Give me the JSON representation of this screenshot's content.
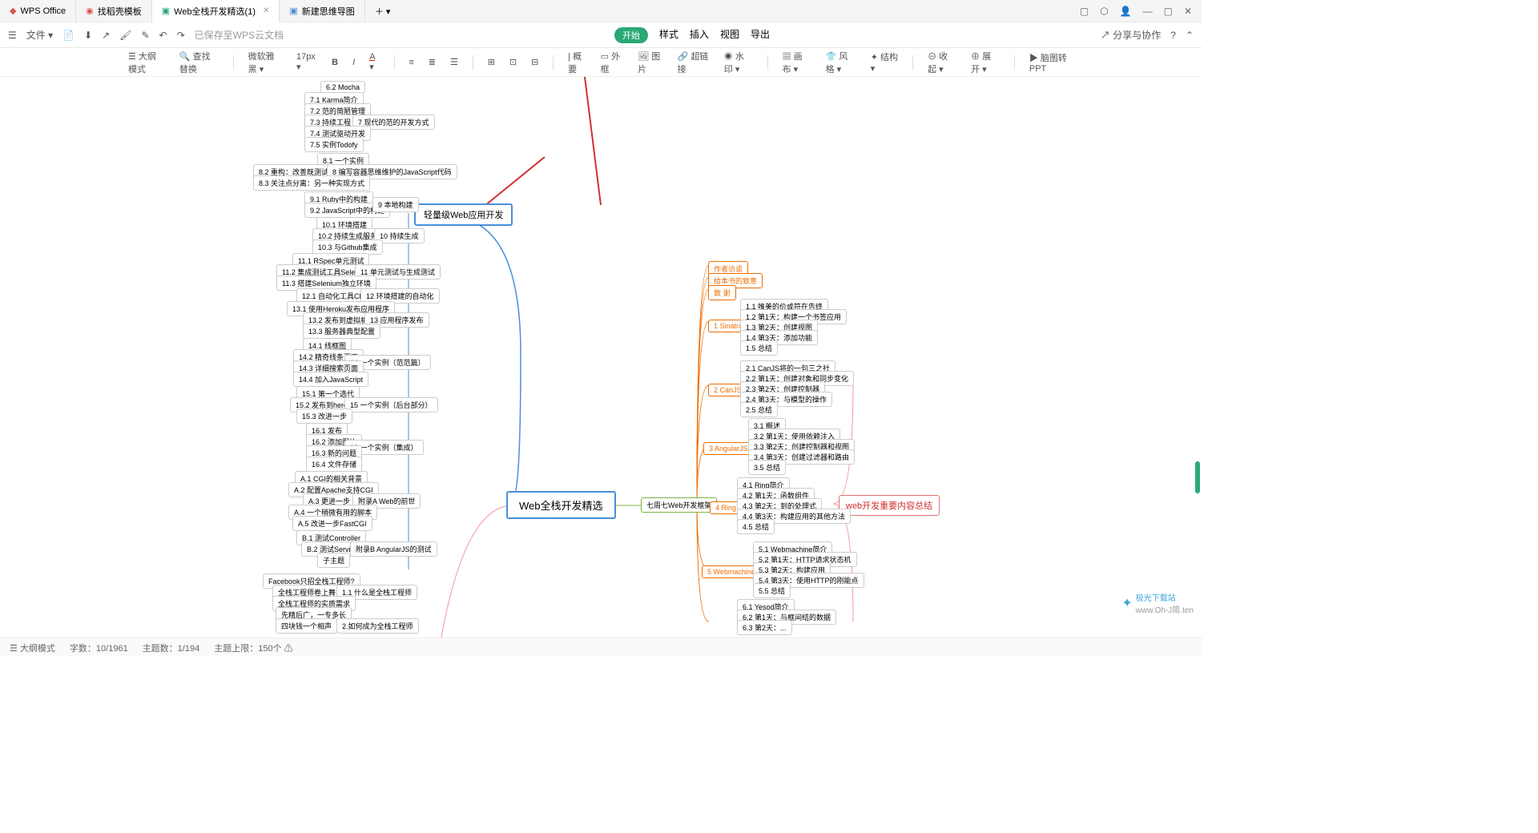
{
  "tabs": {
    "t1": "WPS Office",
    "t2": "找稻壳模板",
    "t3": "Web全栈开发精选(1)",
    "t4": "新建思维导图"
  },
  "menu": {
    "file": "文件",
    "saved": "已保存至WPS云文档",
    "start": "开始",
    "style": "样式",
    "insert": "插入",
    "view": "视图",
    "export": "导出",
    "share": "分享与协作"
  },
  "toolbar": {
    "outline": "大纲模式",
    "findrep": "查找替换",
    "font": "微软雅黑",
    "size": "17px",
    "summary": "概要",
    "border": "外框",
    "image": "图片",
    "link": "超链接",
    "watermark": "水印",
    "canvas": "画布",
    "style2": "风格",
    "structure": "结构",
    "collapse": "收起",
    "expand": "展开",
    "toppt": "脑图转PPT"
  },
  "mind": {
    "selected": "轻量级Web应用开发",
    "center": "Web全栈开发精选",
    "right1": "七周七Web开发框架",
    "right2": "web开发重要内容总结",
    "l1": "6.2 Mocha",
    "l2": "7.1 Karma简介",
    "l3": "7.2 范的简陋管理",
    "l4": "7.3 持续工程",
    "l5": "7.4 测试驱动开发",
    "l6": "7.5 实例Todofy",
    "l7": "7 现代的范的开发方式",
    "l8": "8.1 一个实例",
    "l9": "8.2 重构：改善既测试的代码",
    "l10": "8 编写容器思维维护的JavaScript代码",
    "l11": "8.3 关注点分离：另一种实现方式",
    "l12": "9.1 Ruby中的构建",
    "l13": "9.2 JavaScript中的构建",
    "l14": "9 本地构建",
    "l15": "10.1 环境搭建",
    "l16": "10.2 持续生成服务器",
    "l17": "10.3 与Github集成",
    "l18": "10 持续生成",
    "l19": "11.1 RSpec单元测试",
    "l20": "11.2 集成测试工具Selenium",
    "l21": "11.3 搭建Selenium独立环境",
    "l22": "11 单元测试与生成测试",
    "l23": "12.1 自动化工具Chef",
    "l24": "12 环境搭建的自动化",
    "l25": "13.1 使用Heroku发布应用程序",
    "l26": "13.2 发布到虚拟机器",
    "l27": "13.3 服务器典型配置",
    "l28": "13 应用程序发布",
    "l29": "14.1 线框图",
    "l30": "14.2 精奇线条页面",
    "l31": "14.3 详细搜索页面",
    "l32": "14.4 加入JavaScript",
    "l33": "14 一个实例（范范篇）",
    "l34": "15.1 第一个选代",
    "l35": "15.2 发布到heroku",
    "l36": "15.3 改进一步",
    "l37": "15 一个实例（后台部分）",
    "l38": "16.1 发布",
    "l39": "16.2 添加图片",
    "l40": "16.3 新的问题",
    "l41": "16.4 文件存储",
    "l42": "16 一个实例（集成）",
    "l43": "A.1 CGI的相关背景",
    "l44": "A.2 配置Apache支持CGI",
    "l45": "A.3 更进一步",
    "l46": "A.4 一个稍微有用的脚本",
    "l47": "A.5 改进一步FastCGI",
    "l48": "附录A Web的前世",
    "l49": "B.1 测试Controller",
    "l50": "B.2 测试Service",
    "l51": "子主题",
    "l52": "附录B AngularJS的测试",
    "l53": "Facebook只招全栈工程师?",
    "l54": "全栈工程师卷上舞台",
    "l55": "1.1 什么是全栈工程师",
    "l56": "全栈工程师的实质需求",
    "l57": "先精后广，一专多长",
    "l58": "四块钱一个相声",
    "l59": "2.如何成为全栈工程师",
    "r1": "作者访谈",
    "r2": "给本书的致意",
    "r3": "致 谢",
    "r4": "1.1 唯美的价或符在告终",
    "r5": "1.2 第1天：构建一个书签应用",
    "r6": "1.3 第2天：创建视图",
    "r7": "1.4 第3天：添加功能",
    "r8": "1.5 总结",
    "r9": "1 Sinatra",
    "r10": "2.1 CanJS将的一句三之社",
    "r11": "2.2 第1天：创建对象和同步变化",
    "r12": "2.3 第2天：创建控制器",
    "r13": "2.4 第3天：与模型的操作",
    "r14": "2.5 总结",
    "r15": "2 CanJS",
    "r16": "3.1 概述",
    "r17": "3.2 第1天：使用依赖注入",
    "r18": "3.3 第2天：创建控制器和视图",
    "r19": "3.4 第3天：创建过滤器和路由",
    "r20": "3.5 总结",
    "r21": "3 AngularJS",
    "r22": "4.1 Ring简介",
    "r23": "4.2 第1天：函数组件",
    "r24": "4.3 第2天：到的处理式",
    "r25": "4.4 第3天：构建应用的其他方法",
    "r26": "4.5 总结",
    "r27": "4 Ring",
    "r28": "5.1 Webmachine简介",
    "r29": "5.2 第1天：HTTP请求状态机",
    "r30": "5.3 第2天：构建应用",
    "r31": "5.4 第3天：使用HTTP的刚能点",
    "r32": "5.5 总结",
    "r33": "5 Webmachine",
    "r34": "6.1 Yesod简介",
    "r35": "6.2 第1天：与框间结的数据",
    "r36": "6.3 第2天：..."
  },
  "status": {
    "outline": "大纲模式",
    "words": "字数：10/1961",
    "topics": "主题数：1/194",
    "limit": "主题上限：150个"
  },
  "watermark": {
    "brand": "极光下载站",
    "url": "www.Oh-J简.ten"
  }
}
